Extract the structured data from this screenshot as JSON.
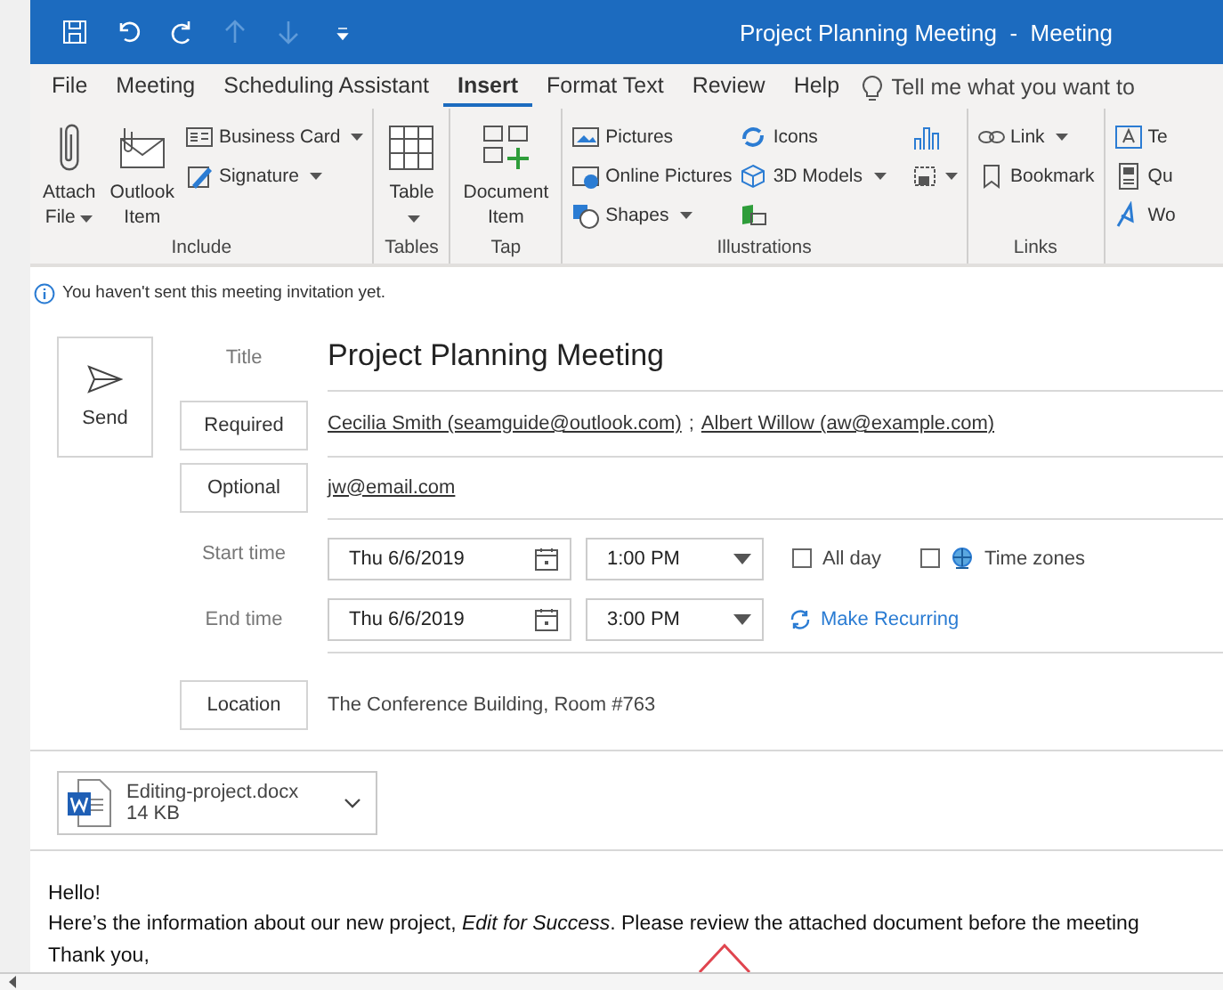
{
  "window": {
    "title": "Project Planning Meeting  -  Meeting"
  },
  "tabs": [
    {
      "label": "File",
      "selected": false
    },
    {
      "label": "Meeting",
      "selected": false
    },
    {
      "label": "Scheduling Assistant",
      "selected": false
    },
    {
      "label": "Insert",
      "selected": true
    },
    {
      "label": "Format Text",
      "selected": false
    },
    {
      "label": "Review",
      "selected": false
    },
    {
      "label": "Help",
      "selected": false
    }
  ],
  "tell_me": {
    "placeholder": "Tell me what you want to"
  },
  "ribbon": {
    "groups": [
      {
        "label": "Include",
        "large": [
          {
            "label": "Attach File",
            "dropdown": true
          },
          {
            "label": "Outlook Item"
          }
        ],
        "small": [
          {
            "label": "Business Card",
            "dropdown": true
          },
          {
            "label": "Signature",
            "dropdown": true
          }
        ]
      },
      {
        "label": "Tables",
        "large": [
          {
            "label": "Table",
            "dropdown": true
          }
        ]
      },
      {
        "label": "Tap",
        "large": [
          {
            "label": "Document Item"
          }
        ]
      },
      {
        "label": "Illustrations",
        "small": [
          {
            "label": "Pictures"
          },
          {
            "label": "Online Pictures"
          },
          {
            "label": "Shapes",
            "dropdown": true
          },
          {
            "label": "Icons"
          },
          {
            "label": "3D Models",
            "dropdown": true
          }
        ]
      },
      {
        "label": "Links",
        "small": [
          {
            "label": "Link",
            "dropdown": true
          },
          {
            "label": "Bookmark"
          }
        ]
      },
      {
        "small": [
          {
            "label": "Te"
          },
          {
            "label": "Qu"
          },
          {
            "label": "Wo"
          }
        ]
      }
    ]
  },
  "form": {
    "notice": "You haven't sent this meeting invitation yet.",
    "send_label": "Send",
    "title_label": "Title",
    "title_value": "Project Planning Meeting",
    "required_label": "Required",
    "attendee_separator": ";",
    "required_attendees": [
      "Cecilia Smith (seamguide@outlook.com)",
      "Albert Willow (aw@example.com)"
    ],
    "optional_label": "Optional",
    "optional_attendees": [
      "jw@email.com"
    ],
    "start_label": "Start time",
    "start_date": "Thu 6/6/2019",
    "start_time": "1:00 PM",
    "all_day": {
      "label": "All day",
      "checked": false
    },
    "time_zones": {
      "label": "Time zones",
      "checked": false
    },
    "end_label": "End time",
    "end_date": "Thu 6/6/2019",
    "end_time": "3:00 PM",
    "recurring_label": "Make Recurring",
    "location_label": "Location",
    "location_value": "The Conference Building, Room #763"
  },
  "attachment": {
    "name": "Editing-project.docx",
    "size": "14 KB"
  },
  "body": {
    "lines": [
      "Hello!",
      "Here’s the information about our new project, *Edit for Success*. Please review the attached document before the meeting",
      "Thank you,"
    ]
  }
}
